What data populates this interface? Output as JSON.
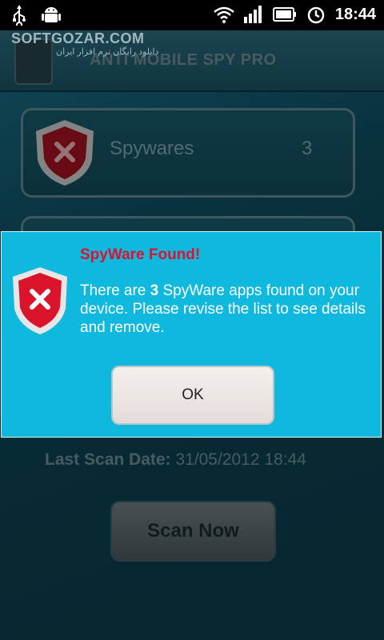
{
  "status_bar": {
    "time": "18:44",
    "left_icons": [
      "usb-icon",
      "android-icon"
    ],
    "right_icons": [
      "wifi-icon",
      "signal-icon",
      "battery-icon",
      "alarm-icon"
    ]
  },
  "watermark": {
    "text": "SOFTGOZAR.COM",
    "subtext": "دانلود رایگان نرم افزار ایران"
  },
  "app": {
    "title": "ANTI MOBILE SPY PRO",
    "cards": [
      {
        "label": "Spywares",
        "count": "3",
        "icon": "shield-x-icon"
      }
    ],
    "last_scan_label": "Last Scan Date:",
    "last_scan_value": "31/05/2012 18:44",
    "scan_button": "Scan Now"
  },
  "dialog": {
    "title": "SpyWare Found!",
    "message_prefix": "There are ",
    "message_count": "3",
    "message_suffix": " SpyWare apps found on your device. Please revise the list to see details and remove.",
    "ok_button": "OK",
    "icon": "shield-x-icon"
  },
  "colors": {
    "dialog_bg": "#0fb8dd",
    "title_red": "#e0112f",
    "shield_red": "#d9142b"
  }
}
